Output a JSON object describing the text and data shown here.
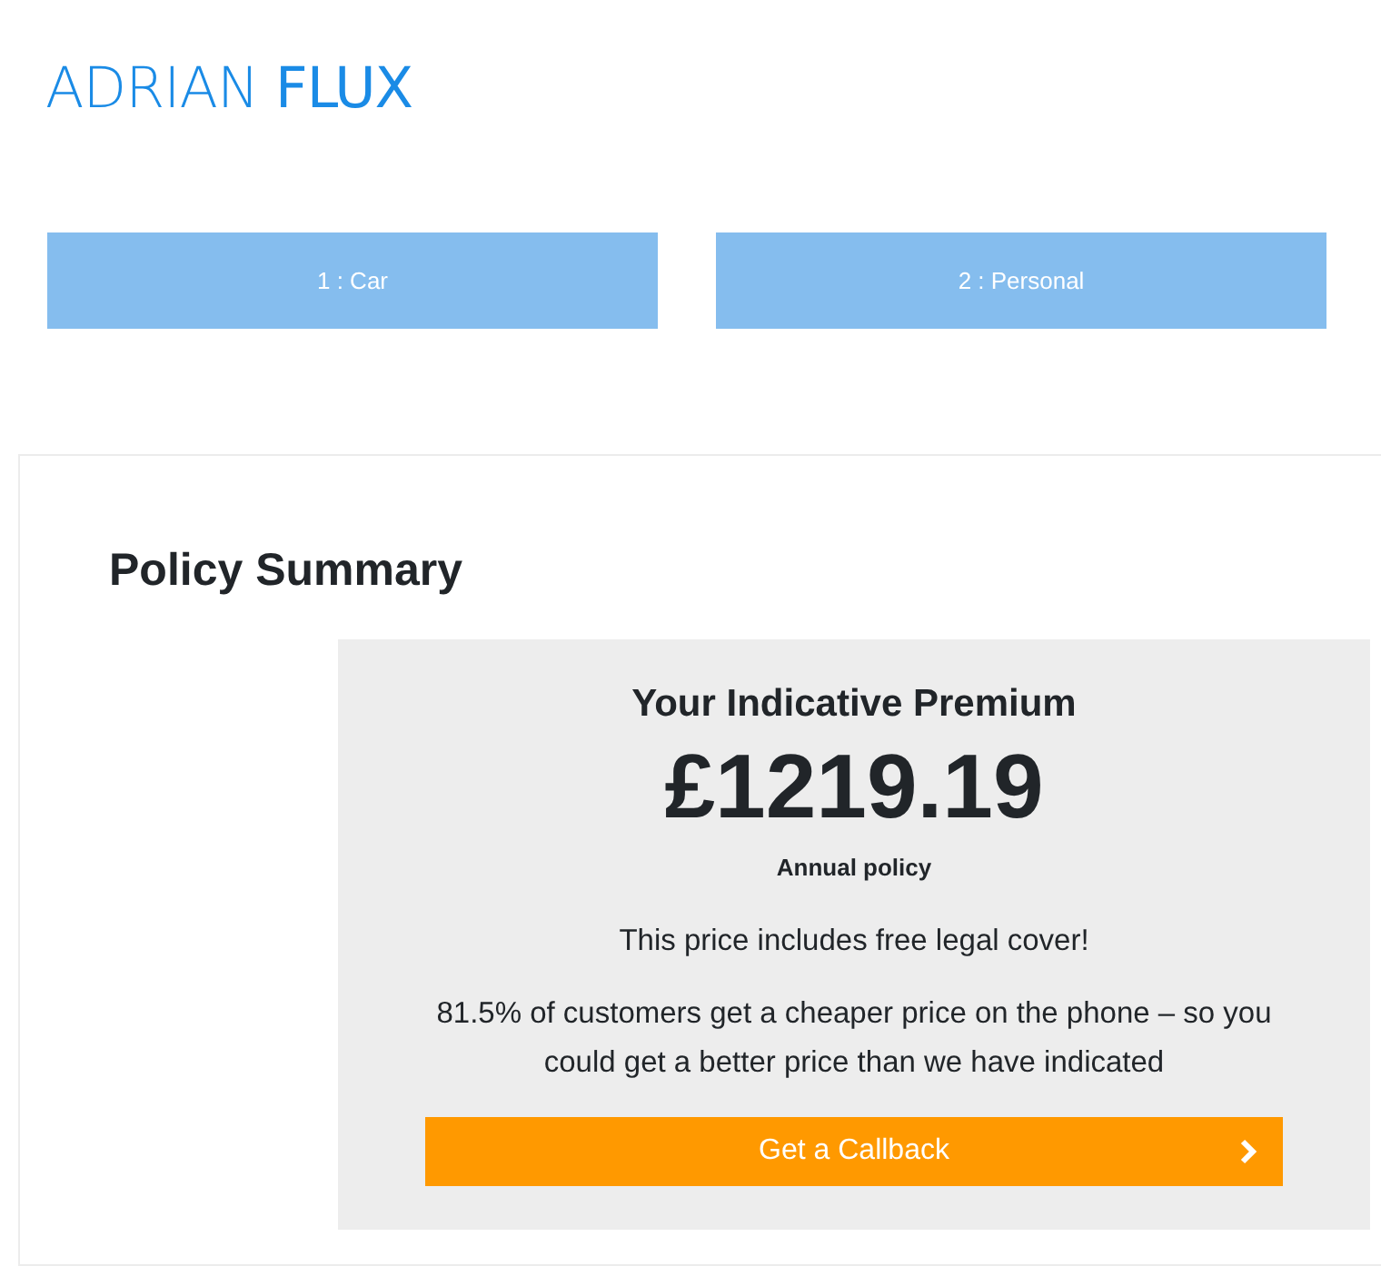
{
  "logo": {
    "text": "ADRIAN **FLUX**"
  },
  "steps": [
    {
      "label": "1 : Car"
    },
    {
      "label": "2 : Personal"
    }
  ],
  "policy_summary": {
    "title": "Policy Summary",
    "premium": {
      "heading": "Your Indicative Premium",
      "price": "£1219.19",
      "term": "Annual policy",
      "notes": [
        "This price includes free legal cover!",
        "81.5% of customers get a cheaper price on the phone – so you could get a better price than we have indicated"
      ],
      "button": "Get a Callback"
    }
  }
}
